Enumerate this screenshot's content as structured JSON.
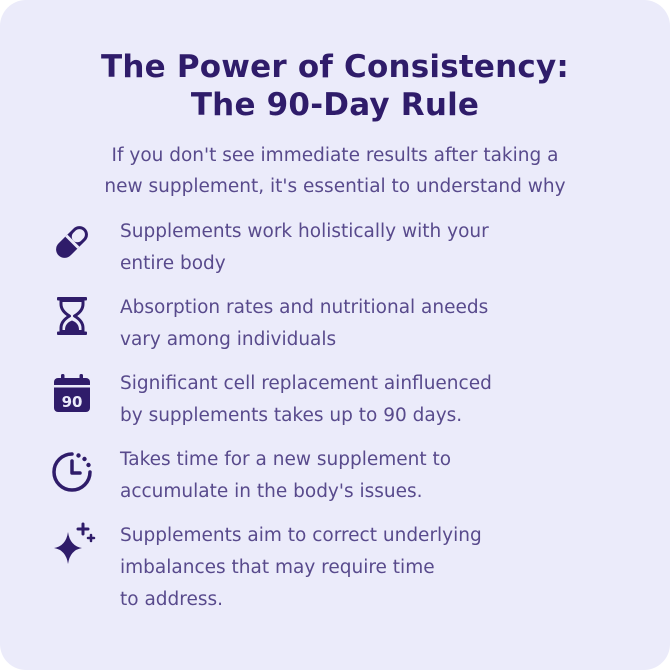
{
  "header": {
    "title_line1": "The Power of Consistency:",
    "title_line2": "The 90-Day Rule",
    "subtitle_line1": "If you don't see immediate results after taking a",
    "subtitle_line2": "new supplement, it's essential to understand why"
  },
  "items": [
    {
      "icon": "pill-icon",
      "lines": [
        "Supplements work holistically with your",
        "entire body"
      ]
    },
    {
      "icon": "hourglass-icon",
      "lines": [
        "Absorption rates and nutritional aneeds",
        "vary among individuals"
      ]
    },
    {
      "icon": "calendar-icon",
      "icon_text": "90",
      "lines": [
        "Significant cell replacement ainfluenced",
        "by supplements takes up to 90 days."
      ]
    },
    {
      "icon": "clock-icon",
      "lines": [
        "Takes time for a new supplement to",
        "accumulate in the body's issues."
      ]
    },
    {
      "icon": "sparkle-icon",
      "lines": [
        "Supplements aim to correct underlying",
        "imbalances that may require time",
        "to address."
      ]
    }
  ],
  "colors": {
    "background": "#ebebfa",
    "title": "#2f1c6a",
    "body_text": "#584a8c",
    "icon": "#2f1c6a"
  }
}
